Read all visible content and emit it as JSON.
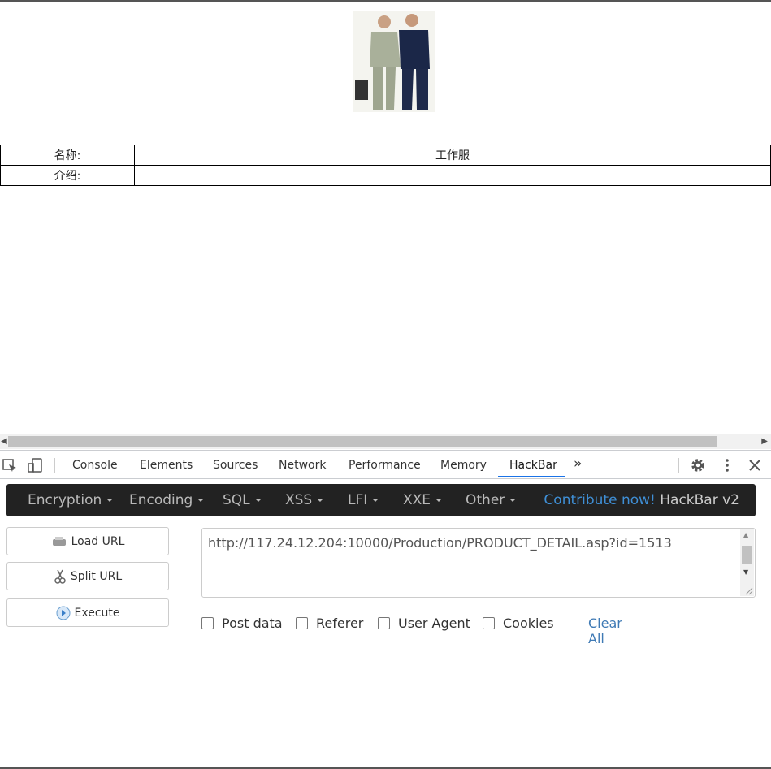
{
  "page": {
    "image_alt": "工作服 product photo",
    "rows": [
      {
        "label": "名称:",
        "value": "工作服"
      },
      {
        "label": "介绍:",
        "value": ""
      }
    ]
  },
  "devtools": {
    "tabs": [
      "Console",
      "Elements",
      "Sources",
      "Network",
      "Performance",
      "Memory",
      "HackBar"
    ],
    "active_tab": "HackBar",
    "more_tabs": "»"
  },
  "hackbar": {
    "menu": [
      "Encryption",
      "Encoding",
      "SQL",
      "XSS",
      "LFI",
      "XXE",
      "Other"
    ],
    "contribute": "Contribute now!",
    "brand": "HackBar v2",
    "buttons": {
      "load": "Load URL",
      "split": "Split URL",
      "execute": "Execute"
    },
    "url": "http://117.24.12.204:10000/Production/PRODUCT_DETAIL.asp?id=1513",
    "options": [
      "Post data",
      "Referer",
      "User Agent",
      "Cookies"
    ],
    "clear_all": "Clear All"
  },
  "colors": {
    "accent": "#1a73e8",
    "hackbar_bg": "#222222",
    "link": "#3f8fd6"
  }
}
